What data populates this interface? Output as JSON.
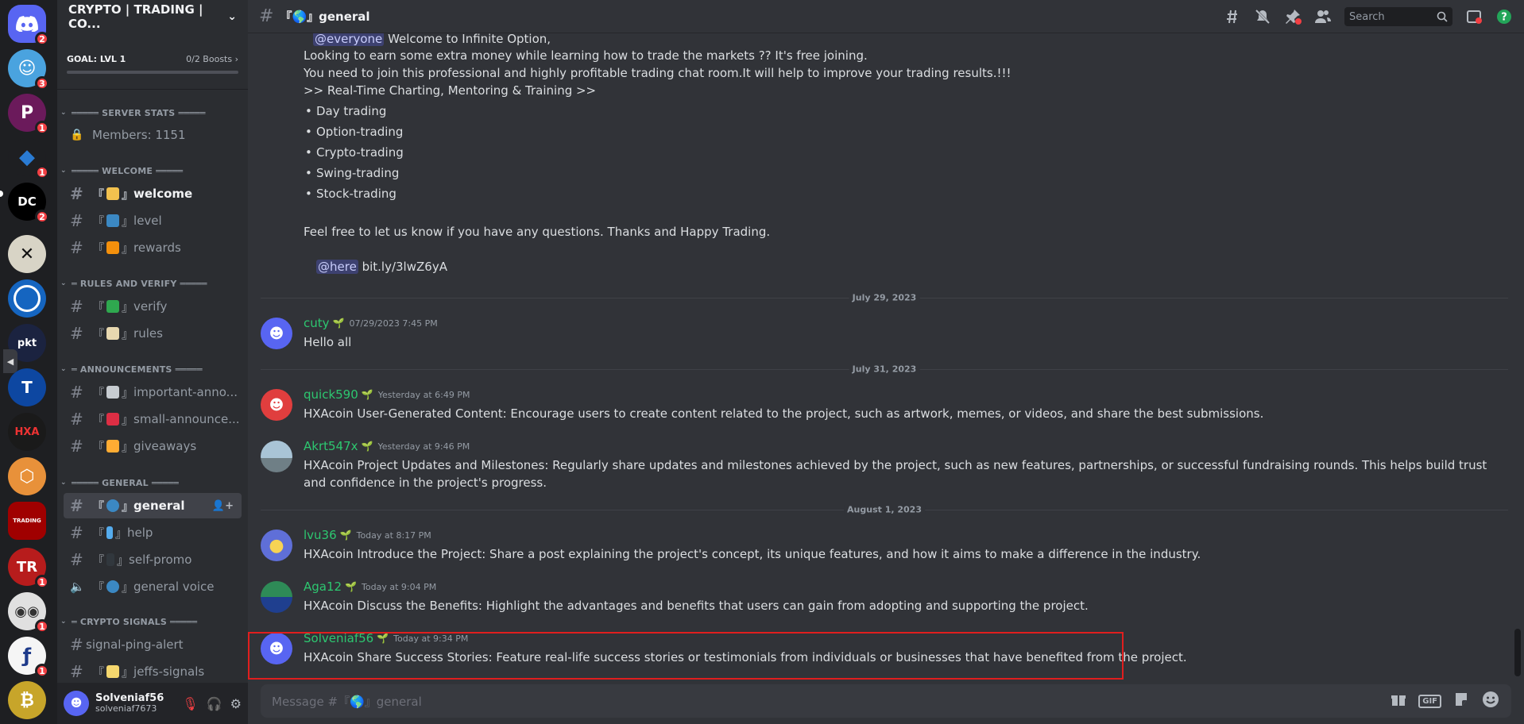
{
  "server": {
    "name": "CRYPTO | TRADING | CO...",
    "goal_label": "GOAL: LVL 1",
    "boosts_label": "0/2 Boosts"
  },
  "rail": {
    "items": [
      {
        "name": "discord-home",
        "badge": "2",
        "color": "#5865f2"
      },
      {
        "name": "server-2",
        "badge": "3",
        "color": "#4aa3df"
      },
      {
        "name": "server-3",
        "badge": "1",
        "color": "#6b1a5b"
      },
      {
        "name": "server-4",
        "badge": "1",
        "color": "#1e1f22"
      },
      {
        "name": "server-5",
        "badge": "2",
        "color": "#000000",
        "text": "DC"
      },
      {
        "name": "server-6",
        "badge": "",
        "color": "#d8d4c6"
      },
      {
        "name": "server-7",
        "badge": "",
        "color": "#1565c0"
      },
      {
        "name": "server-8",
        "badge": "",
        "color": "#1b2340",
        "text": "pkt"
      },
      {
        "name": "server-9",
        "badge": "",
        "color": "#0d47a1"
      },
      {
        "name": "server-10",
        "badge": "",
        "color": "#1a1a1a",
        "text": "HXA"
      },
      {
        "name": "server-11",
        "badge": "",
        "color": "#e8913a"
      },
      {
        "name": "server-12",
        "badge": "",
        "color": "#a00000",
        "text": "TRADING"
      },
      {
        "name": "server-13",
        "badge": "1",
        "color": "#b71c1c"
      },
      {
        "name": "server-14",
        "badge": "1",
        "color": "#e0e0e0"
      },
      {
        "name": "server-15",
        "badge": "1",
        "color": "#f5f5f5"
      },
      {
        "name": "server-16",
        "badge": "",
        "color": "#c7a52a"
      }
    ]
  },
  "sidebar": {
    "categories": {
      "server_stats": "═════ SERVER STATS ═════",
      "welcome": "═════ WELCOME ═════",
      "rules": "═ RULES AND VERIFY ═════",
      "announcements": "═ ANNOUNCEMENTS ═════",
      "general": "═════ GENERAL ═════",
      "crypto": "═ CRYPTO SIGNALS ═════"
    },
    "members": "Members: 1151",
    "channels": {
      "welcome": "welcome",
      "level": "level",
      "rewards": "rewards",
      "verify": "verify",
      "rules": "rules",
      "important": "important-anno...",
      "small": "small-announce...",
      "giveaways": "giveaways",
      "general": "general",
      "help": "help",
      "selfpromo": "self-promo",
      "generalvoice": "general voice",
      "signalping": "signal-ping-alert",
      "jeffs": "jeffs-signals"
    },
    "bracket_open": "『",
    "bracket_close": "』"
  },
  "user": {
    "name": "Solveniaf56",
    "tag": "solveniaf7673"
  },
  "topbar": {
    "channel": "『🌎』general",
    "search_placeholder": "Search"
  },
  "announcement": {
    "mention": "@everyone",
    "line1_rest": " Welcome to Infinite Option,",
    "line2": "Looking to earn some extra money while learning how to trade the markets ??  It's free joining.",
    "line3": "You need to join this professional and highly profitable trading chat room.It will help to improve your trading results.!!!",
    "line4": ">> Real-Time Charting, Mentoring & Training >>",
    "bullets": [
      "Day trading",
      "Option-trading",
      "Crypto-trading",
      "Swing-trading",
      "Stock-trading"
    ],
    "footer": "Feel free to let us know if you have any questions. Thanks and Happy Trading.",
    "here": "@here",
    "link": " bit.ly/3lwZ6yA"
  },
  "separators": [
    "July 29, 2023",
    "July 31, 2023",
    "August 1, 2023"
  ],
  "messages": [
    {
      "user": "cuty",
      "time": "07/29/2023 7:45 PM",
      "text": "Hello all"
    },
    {
      "user": "quick590",
      "time": "Yesterday at 6:49 PM",
      "text": "HXAcoin User-Generated Content: Encourage users to create content related to the project, such as artwork, memes, or videos, and share the best submissions."
    },
    {
      "user": "Akrt547x",
      "time": "Yesterday at 9:46 PM",
      "text": "HXAcoin Project Updates and Milestones: Regularly share updates and milestones achieved by the project, such as new features, partnerships, or successful fundraising rounds. This helps build trust and confidence in the project's progress."
    },
    {
      "user": "lvu36",
      "time": "Today at 8:17 PM",
      "text": "HXAcoin Introduce the Project: Share a post explaining the project's concept, its unique features, and how it aims to make a difference in the industry."
    },
    {
      "user": "Aga12",
      "time": "Today at 9:04 PM",
      "text": "HXAcoin Discuss the Benefits: Highlight the advantages and benefits that users can gain from adopting and supporting the project."
    },
    {
      "user": "Solveniaf56",
      "time": "Today at 9:34 PM",
      "text": "HXAcoin Share Success Stories: Feature real-life success stories or testimonials from individuals or businesses that have benefited from the project."
    }
  ],
  "composer": {
    "placeholder": "Message #『🌎』general",
    "gif": "GIF"
  }
}
